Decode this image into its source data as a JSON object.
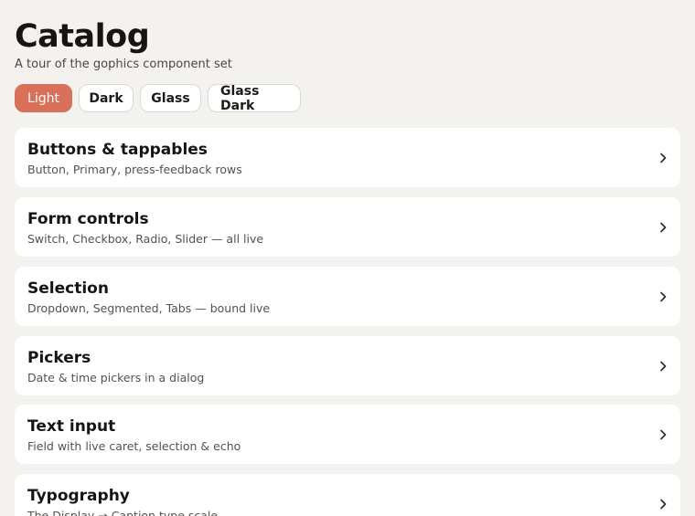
{
  "header": {
    "title": "Catalog",
    "subtitle": "A tour of the gophics component set"
  },
  "themes": {
    "selected": "Light",
    "items": [
      {
        "label": "Light"
      },
      {
        "label": "Dark"
      },
      {
        "label": "Glass"
      },
      {
        "label": "Glass Dark"
      }
    ]
  },
  "sections": [
    {
      "title": "Buttons & tappables",
      "description": "Button, Primary, press-feedback rows",
      "icon": "chevron-right-icon"
    },
    {
      "title": "Form controls",
      "description": "Switch, Checkbox, Radio, Slider — all live",
      "icon": "chevron-right-icon"
    },
    {
      "title": "Selection",
      "description": "Dropdown, Segmented, Tabs — bound live",
      "icon": "chevron-right-icon"
    },
    {
      "title": "Pickers",
      "description": "Date & time pickers in a dialog",
      "icon": "chevron-right-icon"
    },
    {
      "title": "Text input",
      "description": "Field with live caret, selection & echo",
      "icon": "chevron-right-icon"
    },
    {
      "title": "Typography",
      "description": "The Display → Caption type scale",
      "icon": "chevron-right-icon"
    }
  ],
  "colors": {
    "background": "#f4f2ef",
    "accent": "#d9705a",
    "card": "#ffffff"
  }
}
